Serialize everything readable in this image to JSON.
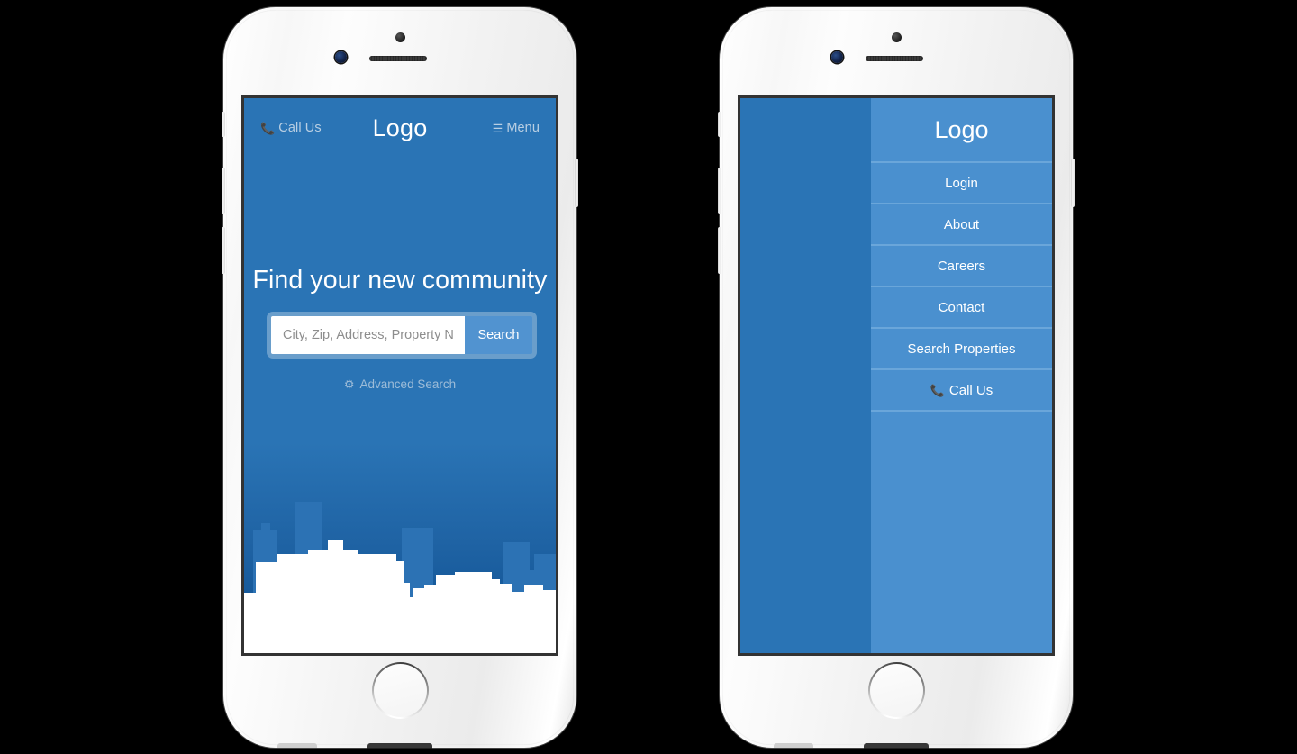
{
  "page": {
    "background": "#000000",
    "accent_blue": "#2a74b5",
    "menu_blue": "#4a90cf",
    "deep_blue": "#0d4f90",
    "building_blue": "#2c72b4"
  },
  "topbar": {
    "call_label": "Call Us",
    "call_icon": "phone-icon",
    "logo": "Logo",
    "menu_label": "Menu",
    "menu_icon": "hamburger-icon",
    "menu_close_icon": "close-icon"
  },
  "hero": {
    "title": "Find your new community",
    "search": {
      "placeholder": "City, Zip, Address, Property Name",
      "value": "",
      "button_label": "Search"
    },
    "advanced": {
      "label": "Advanced Search",
      "icon": "gear-icon"
    }
  },
  "menu_panel": {
    "logo": "Logo",
    "items": [
      {
        "label": "Login",
        "icon": ""
      },
      {
        "label": "About",
        "icon": ""
      },
      {
        "label": "Careers",
        "icon": ""
      },
      {
        "label": "Contact",
        "icon": ""
      },
      {
        "label": "Search Properties",
        "icon": ""
      },
      {
        "label": "Call Us",
        "icon": "phone-icon"
      }
    ]
  },
  "phones": [
    {
      "name": "phone-closed-menu",
      "state": "menu closed"
    },
    {
      "name": "phone-open-menu",
      "state": "menu open"
    }
  ]
}
